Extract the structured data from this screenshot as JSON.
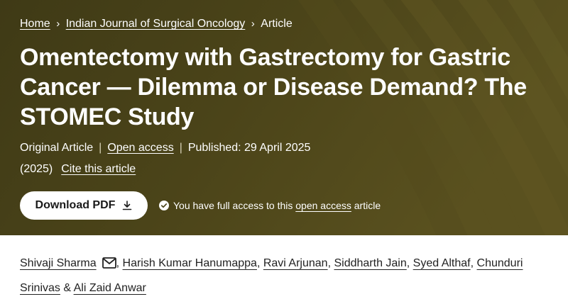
{
  "breadcrumb": {
    "home": "Home",
    "journal": "Indian Journal of Surgical Oncology",
    "current": "Article"
  },
  "article": {
    "title": "Omentectomy with Gastrectomy for Gastric Cancer — Dilemma or Disease Demand? The STOMEC Study",
    "type": "Original Article",
    "open_access": "Open access",
    "published": "Published: 29 April 2025",
    "year": "(2025)",
    "cite": "Cite this article"
  },
  "actions": {
    "download_pdf": "Download PDF",
    "access_prefix": "You have full access to this",
    "access_link": "open access",
    "access_suffix": "article"
  },
  "authors": {
    "a1": "Shivaji Sharma",
    "a2": "Harish Kumar Hanumappa",
    "a3": "Ravi Arjunan",
    "a4": "Siddharth Jain",
    "a5": "Syed Althaf",
    "a6": "Chunduri Srinivas",
    "a7": "Ali Zaid Anwar",
    "comma": ",",
    "and": "&"
  },
  "colors": {
    "hero_background": "#4a4319",
    "text_on_hero": "#ffffff",
    "body_text": "#222222"
  },
  "icons": [
    "chevron-right-icon",
    "download-icon",
    "check-circle-icon",
    "mail-icon"
  ]
}
